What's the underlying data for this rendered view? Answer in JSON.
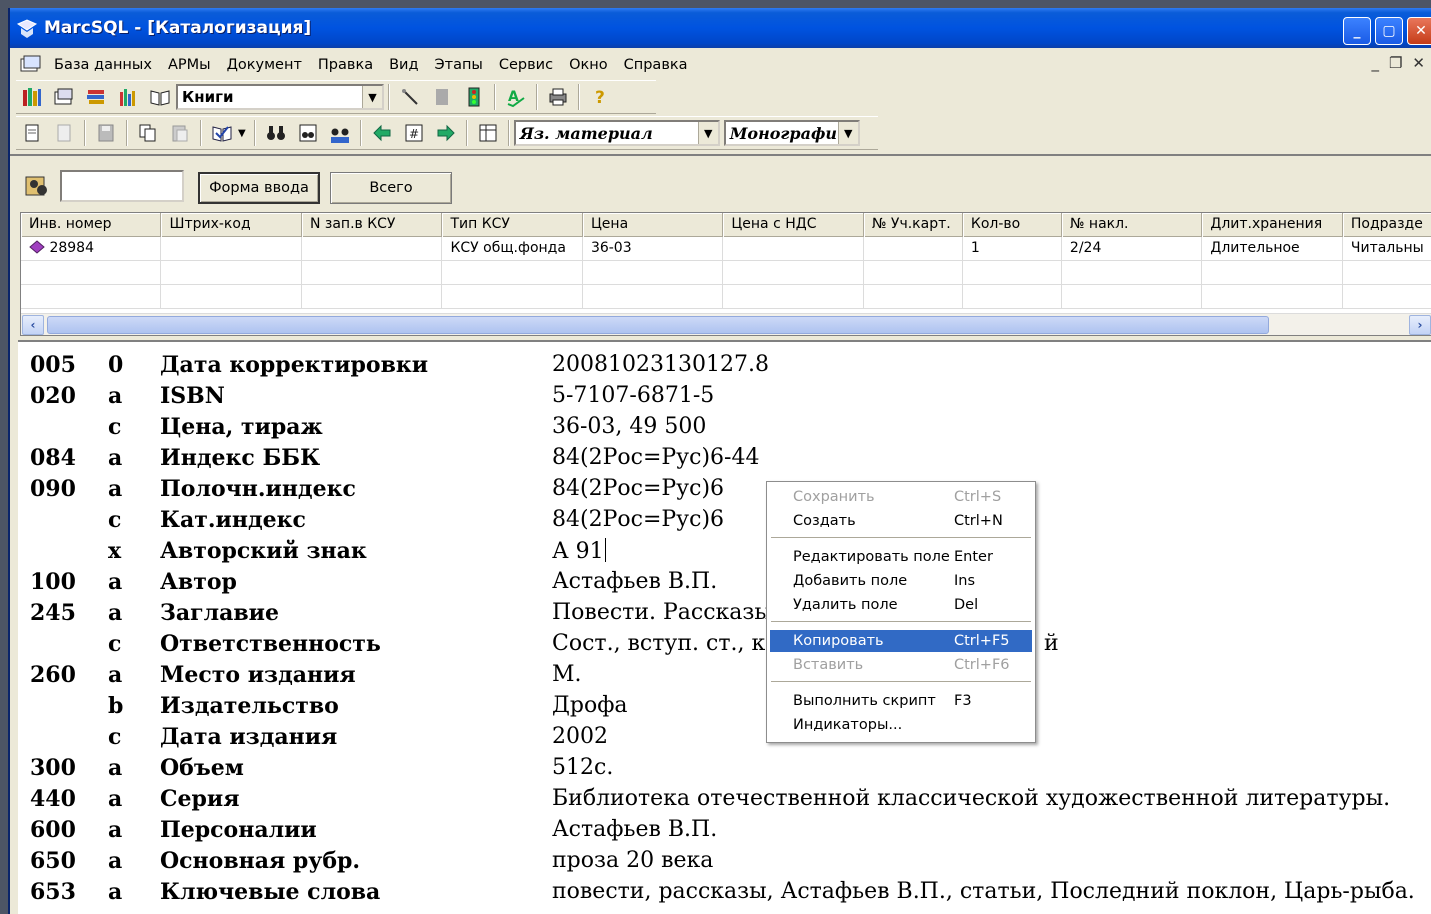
{
  "window": {
    "title": "MarcSQL - [Каталогизация]"
  },
  "menu": [
    "База данных",
    "АРМы",
    "Документ",
    "Правка",
    "Вид",
    "Этапы",
    "Сервис",
    "Окно",
    "Справка"
  ],
  "toolbar": {
    "doc_type_combo": "Книги",
    "lang_combo": "Яз. материал",
    "form_combo": "Монографи"
  },
  "search": {
    "input_value": "",
    "form_button": "Форма ввода",
    "all_button": "Всего"
  },
  "grid": {
    "headers": [
      "Инв. номер",
      "Штрих-код",
      "N зап.в КСУ",
      "Тип КСУ",
      "Цена",
      "Цена с НДС",
      "№ Уч.карт.",
      "Кол-во",
      "№ накл.",
      "Длит.хранения",
      "Подразде"
    ],
    "rows": [
      [
        "28984",
        "",
        "",
        "КСУ общ.фонда",
        "36-03",
        "",
        "",
        "1",
        "2/24",
        "Длительное",
        "Читальны"
      ],
      [
        "",
        "",
        "",
        "",
        "",
        "",
        "",
        "",
        "",
        "",
        ""
      ],
      [
        "",
        "",
        "",
        "",
        "",
        "",
        "",
        "",
        "",
        "",
        ""
      ]
    ]
  },
  "marc": [
    {
      "tag": "005",
      "sub": "0",
      "name": "Дата корректировки",
      "value": "20081023130127.8"
    },
    {
      "tag": "020",
      "sub": "a",
      "name": "ISBN",
      "value": "5-7107-6871-5"
    },
    {
      "tag": "",
      "sub": "c",
      "name": "Цена, тираж",
      "value": "36-03, 49 500"
    },
    {
      "tag": "084",
      "sub": "a",
      "name": "Индекс ББК",
      "value": "84(2Рос=Рус)6-44"
    },
    {
      "tag": "090",
      "sub": "a",
      "name": "Полочн.индекс",
      "value": "84(2Рос=Рус)6"
    },
    {
      "tag": "",
      "sub": "c",
      "name": "Кат.индекс",
      "value": "84(2Рос=Рус)6"
    },
    {
      "tag": "",
      "sub": "x",
      "name": "Авторский знак",
      "value": "А 91"
    },
    {
      "tag": "100",
      "sub": "a",
      "name": "Автор",
      "value": "Астафьев В.П."
    },
    {
      "tag": "245",
      "sub": "a",
      "name": "Заглавие",
      "value": "Повести. Рассказы"
    },
    {
      "tag": "",
      "sub": "c",
      "name": "Ответственность",
      "value": "Сост., вступ. ст., к"
    },
    {
      "tag": "260",
      "sub": "a",
      "name": "Место издания",
      "value": "М."
    },
    {
      "tag": "",
      "sub": "b",
      "name": "Издательство",
      "value": "Дрофа"
    },
    {
      "tag": "",
      "sub": "c",
      "name": "Дата издания",
      "value": "2002"
    },
    {
      "tag": "300",
      "sub": "a",
      "name": "Объем",
      "value": "512с."
    },
    {
      "tag": "440",
      "sub": "a",
      "name": "Серия",
      "value": "Библиотека отечественной классической художественной литературы."
    },
    {
      "tag": "600",
      "sub": "a",
      "name": "Персоналии",
      "value": "Астафьев В.П."
    },
    {
      "tag": "650",
      "sub": "a",
      "name": "Основная рубр.",
      "value": "проза 20 века"
    },
    {
      "tag": "653",
      "sub": "a",
      "name": "Ключевые слова",
      "value": "повести, рассказы, Астафьев В.П., статьи, Последний поклон, Царь-рыба."
    }
  ],
  "marc_overflow_char": "й",
  "context_menu": [
    {
      "label": "Сохранить",
      "key": "Ctrl+S",
      "disabled": true
    },
    {
      "label": "Создать",
      "key": "Ctrl+N",
      "disabled": false
    },
    {
      "label": "Редактировать поле",
      "key": "Enter",
      "disabled": false
    },
    {
      "label": "Добавить поле",
      "key": "Ins",
      "disabled": false
    },
    {
      "label": "Удалить поле",
      "key": "Del",
      "disabled": false
    },
    {
      "label": "Копировать",
      "key": "Ctrl+F5",
      "disabled": false,
      "selected": true
    },
    {
      "label": "Вставить",
      "key": "Ctrl+F6",
      "disabled": true
    },
    {
      "label": "Выполнить скрипт",
      "key": "F3",
      "disabled": false
    },
    {
      "label": "Индикаторы...",
      "key": "",
      "disabled": false
    }
  ],
  "colors": {
    "titlebar": "#0053e0",
    "selection": "#316ac5",
    "scroll_thumb": "#aec3f0"
  }
}
